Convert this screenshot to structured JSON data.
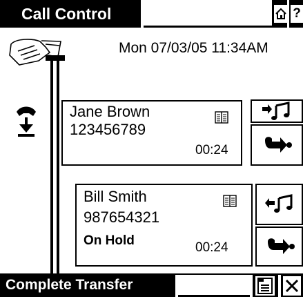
{
  "header": {
    "title": "Call Control",
    "home_icon": "home-icon",
    "help_label": "?"
  },
  "status": {
    "datetime": "Mon 07/03/05 11:34AM"
  },
  "calls": [
    {
      "name": "Jane Brown",
      "number": "123456789",
      "state": "",
      "timer": "00:24",
      "directory_icon": "phonebook-icon",
      "action_icons": [
        "music-on-hold-icon",
        "call-transfer-icon"
      ]
    },
    {
      "name": "Bill Smith",
      "number": "987654321",
      "state": "On Hold",
      "timer": "00:24",
      "directory_icon": "phonebook-icon",
      "action_icons": [
        "resume-music-icon",
        "call-transfer-icon"
      ]
    }
  ],
  "footer": {
    "complete_transfer_label": "Complete Transfer",
    "menu_icon": "menu-list-icon",
    "close_icon": "close-icon"
  }
}
